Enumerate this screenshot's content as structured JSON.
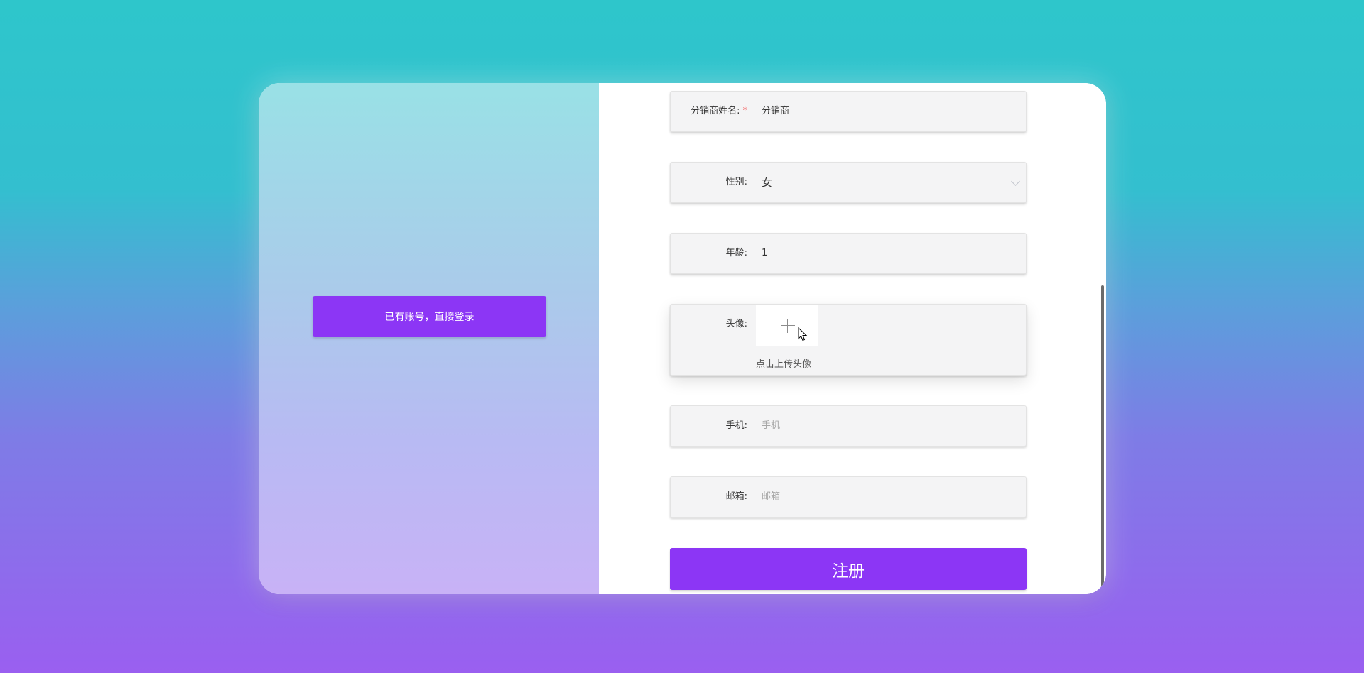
{
  "left_panel": {
    "login_button_label": "已有账号，直接登录"
  },
  "form": {
    "name": {
      "label": "分销商姓名:",
      "required_mark": "*",
      "value": "分销商"
    },
    "gender": {
      "label": "性别:",
      "value": "女"
    },
    "age": {
      "label": "年龄:",
      "value": "1"
    },
    "avatar": {
      "label": "头像:",
      "hint": "点击上传头像"
    },
    "phone": {
      "label": "手机:",
      "placeholder": "手机"
    },
    "email": {
      "label": "邮箱:",
      "placeholder": "邮箱"
    },
    "submit_label": "注册"
  },
  "colors": {
    "accent": "#8c36f5",
    "required": "#f56c6c"
  },
  "icons": {
    "upload": "plus-icon",
    "select": "chevron-down-icon",
    "pointer": "mouse-cursor-icon"
  }
}
